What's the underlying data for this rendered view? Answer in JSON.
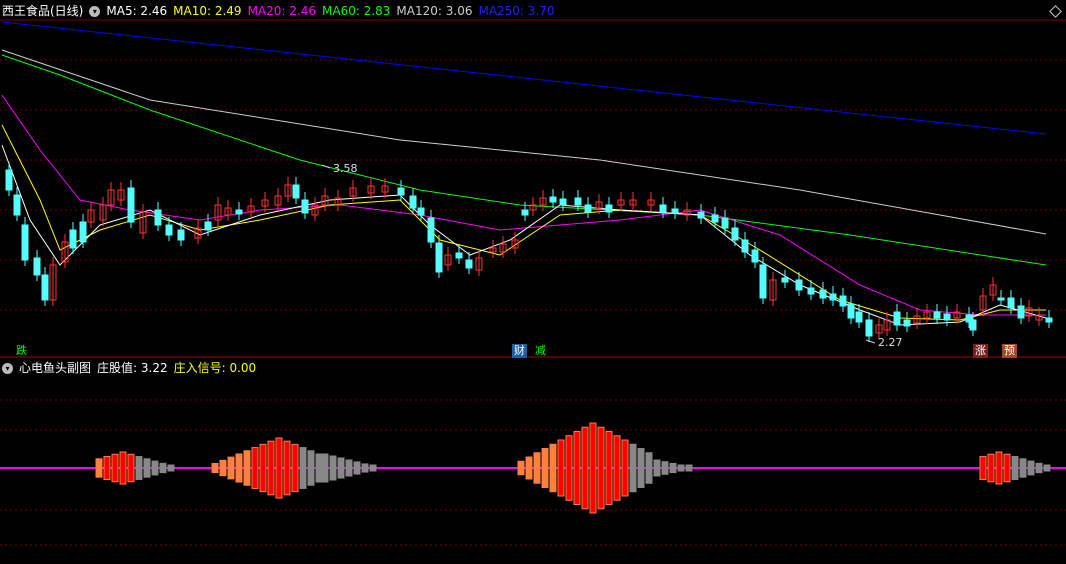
{
  "main_panel": {
    "title": "西王食品(日线)",
    "indicators": [
      {
        "label": "MA5: 2.46",
        "color": "#ffffff"
      },
      {
        "label": "MA10: 2.49",
        "color": "#ffff00"
      },
      {
        "label": "MA20: 2.46",
        "color": "#ff00ff"
      },
      {
        "label": "MA60: 2.83",
        "color": "#00ff00"
      },
      {
        "label": "MA120: 3.06",
        "color": "#cccccc"
      },
      {
        "label": "MA250: 3.70",
        "color": "#0000ff"
      }
    ],
    "high_marker": "3.58",
    "low_marker": "2.27",
    "tags": [
      {
        "text": "跌",
        "color": "#00ff00",
        "bg": "transparent"
      },
      {
        "text": "财",
        "color": "#ffffff",
        "bg": "#1f5f9f"
      },
      {
        "text": "减",
        "color": "#00ff00",
        "bg": "transparent"
      },
      {
        "text": "涨",
        "color": "#ffffff",
        "bg": "#7a1f1f"
      },
      {
        "text": "预",
        "color": "#ffffff",
        "bg": "#a04a20"
      }
    ]
  },
  "sub_panel": {
    "title": "心电鱼头副图",
    "value1": "庄股值: 3.22",
    "value2": "庄入信号: 0.00",
    "value2_color": "#ffff00"
  },
  "colors": {
    "up": "#ff3333",
    "down": "#54ffff",
    "grid": "#8b0000",
    "ma5": "#ffffff",
    "ma10": "#ffff00",
    "ma20": "#ff00ff",
    "ma60": "#00ff00",
    "ma120": "#cccccc",
    "ma250": "#0000ff",
    "bar_red": "#ff0000",
    "bar_orange": "#ff8040",
    "bar_gray": "#888888",
    "baseline": "#ff00ff"
  }
}
